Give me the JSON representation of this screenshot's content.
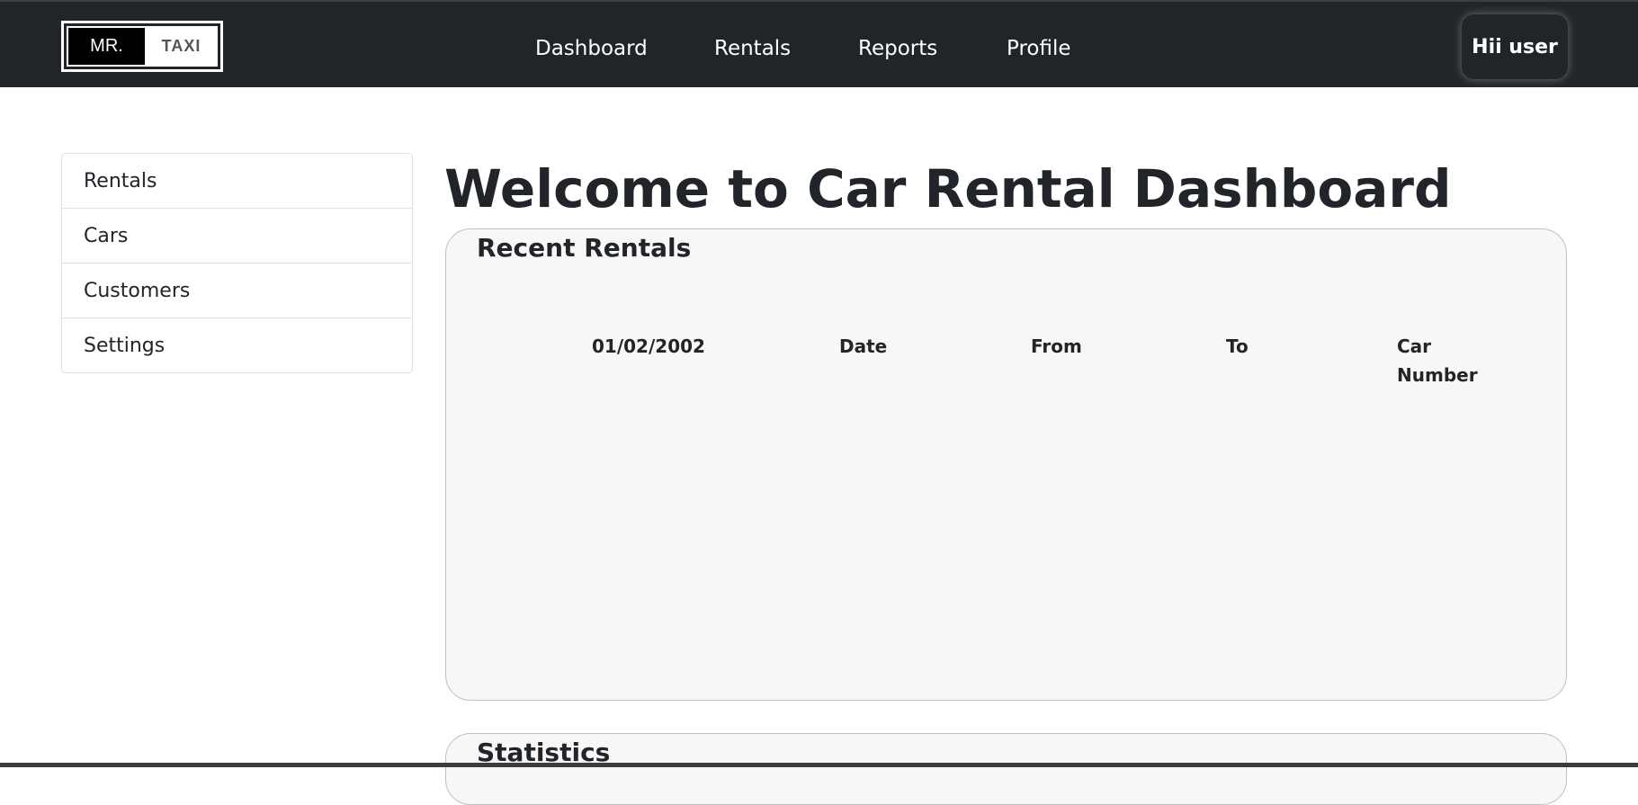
{
  "logo": {
    "part1": "MR.",
    "part2": "TAXI"
  },
  "nav": {
    "links": [
      {
        "label": "Dashboard"
      },
      {
        "label": "Rentals"
      },
      {
        "label": "Reports"
      },
      {
        "label": "Profile"
      }
    ],
    "user_button": "Hii user"
  },
  "sidebar": {
    "items": [
      {
        "label": "Rentals"
      },
      {
        "label": "Cars"
      },
      {
        "label": "Customers"
      },
      {
        "label": "Settings"
      }
    ]
  },
  "main": {
    "title": "Welcome to Car Rental Dashboard",
    "recent_rentals": {
      "title": "Recent Rentals",
      "columns": [
        "01/02/2002",
        "Date",
        "From",
        "To",
        "Car Number"
      ]
    },
    "statistics": {
      "title": "Statistics"
    }
  }
}
